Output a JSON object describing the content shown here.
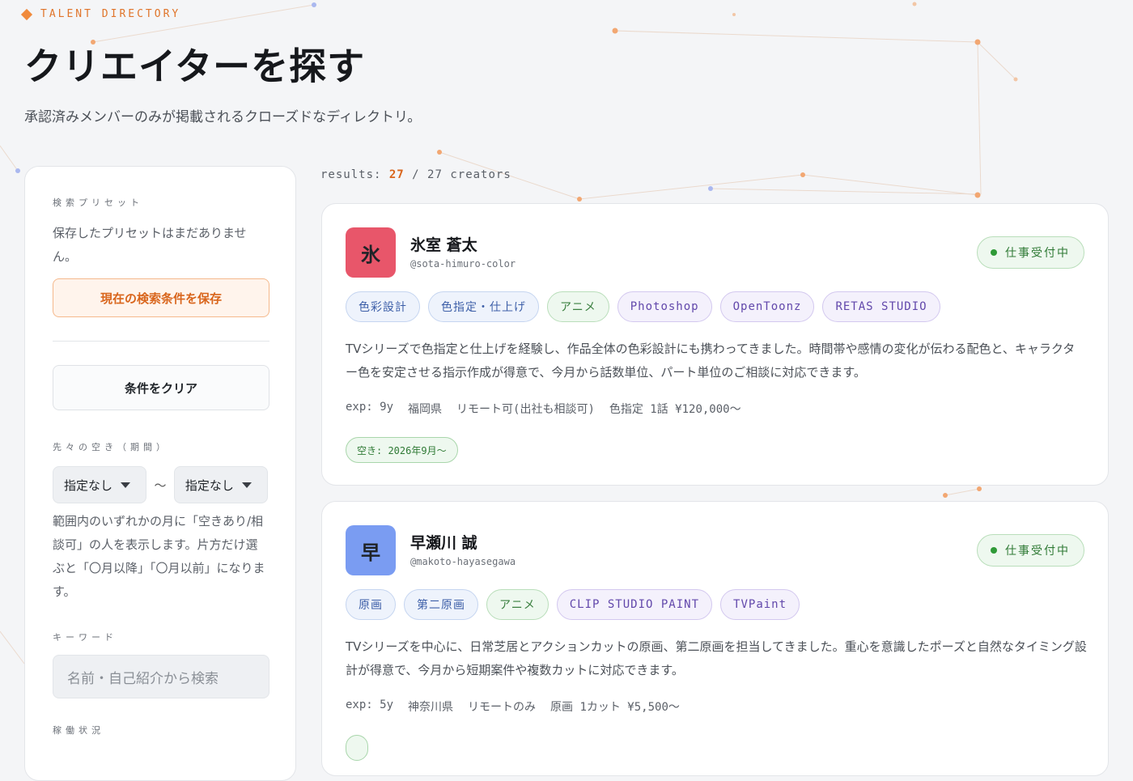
{
  "header": {
    "eyebrow": "TALENT DIRECTORY",
    "title": "クリエイターを探す",
    "subtitle": "承認済みメンバーのみが掲載されるクローズドなディレクトリ。"
  },
  "sidebar": {
    "presets_label": "検索プリセット",
    "presets_empty": "保存したプリセットはまだありません。",
    "save_button": "現在の検索条件を保存",
    "clear_button": "条件をクリア",
    "period_label": "先々の空き（期間）",
    "period_from": "指定なし",
    "period_separator": "〜",
    "period_to": "指定なし",
    "period_help": "範囲内のいずれかの月に「空きあり/相談可」の人を表示します。片方だけ選ぶと「〇月以降」「〇月以前」になります。",
    "keyword_label": "キーワード",
    "keyword_placeholder": "名前・自己紹介から検索",
    "status_label": "稼働状況"
  },
  "results": {
    "prefix": "results:",
    "shown": "27",
    "separator": "/",
    "total": "27 creators"
  },
  "creators": [
    {
      "avatar_char": "氷",
      "avatar_color": "#e8566a",
      "name": "氷室 蒼太",
      "handle": "@sota-himuro-color",
      "status": "仕事受付中",
      "tags": [
        {
          "label": "色彩設計",
          "kind": "role"
        },
        {
          "label": "色指定・仕上げ",
          "kind": "role"
        },
        {
          "label": "アニメ",
          "kind": "genre"
        },
        {
          "label": "Photoshop",
          "kind": "tool"
        },
        {
          "label": "OpenToonz",
          "kind": "tool"
        },
        {
          "label": "RETAS STUDIO",
          "kind": "tool"
        }
      ],
      "bio": "TVシリーズで色指定と仕上げを経験し、作品全体の色彩設計にも携わってきました。時間帯や感情の変化が伝わる配色と、キャラクター色を安定させる指示作成が得意で、今月から話数単位、パート単位のご相談に対応できます。",
      "meta": {
        "exp": "exp: 9y",
        "location": "福岡県",
        "remote": "リモート可(出社も相談可)",
        "rate": "色指定 1話 ¥120,000〜"
      },
      "availability": "空き: 2026年9月〜"
    },
    {
      "avatar_char": "早",
      "avatar_color": "#7a9cf2",
      "name": "早瀬川 誠",
      "handle": "@makoto-hayasegawa",
      "status": "仕事受付中",
      "tags": [
        {
          "label": "原画",
          "kind": "role"
        },
        {
          "label": "第二原画",
          "kind": "role"
        },
        {
          "label": "アニメ",
          "kind": "genre"
        },
        {
          "label": "CLIP STUDIO PAINT",
          "kind": "tool"
        },
        {
          "label": "TVPaint",
          "kind": "tool"
        }
      ],
      "bio": "TVシリーズを中心に、日常芝居とアクションカットの原画、第二原画を担当してきました。重心を意識したポーズと自然なタイミング設計が得意で、今月から短期案件や複数カットに対応できます。",
      "meta": {
        "exp": "exp: 5y",
        "location": "神奈川県",
        "remote": "リモートのみ",
        "rate": "原画 1カット ¥5,500〜"
      },
      "availability": ""
    }
  ],
  "colors": {
    "accent": "#f08a3c",
    "status_green": "#2f9a37"
  }
}
